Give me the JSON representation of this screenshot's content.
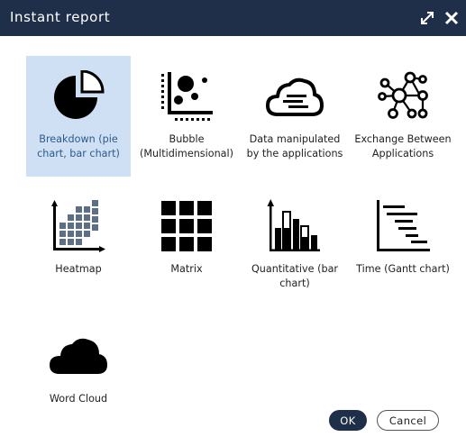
{
  "dialog": {
    "title": "Instant report",
    "expand_icon": "expand-icon",
    "close_icon": "close-icon"
  },
  "tiles": [
    {
      "label": "Breakdown (pie chart, bar chart)",
      "icon": "pie-chart-icon",
      "selected": true
    },
    {
      "label": "Bubble (Multidimensional)",
      "icon": "bubble-chart-icon",
      "selected": false
    },
    {
      "label": "Data manipulated by the applications",
      "icon": "cloud-data-icon",
      "selected": false
    },
    {
      "label": "Exchange Between Applications",
      "icon": "network-graph-icon",
      "selected": false
    },
    {
      "label": "Heatmap",
      "icon": "heatmap-icon",
      "selected": false
    },
    {
      "label": "Matrix",
      "icon": "matrix-grid-icon",
      "selected": false
    },
    {
      "label": "Quantitative (bar chart)",
      "icon": "bar-chart-icon",
      "selected": false
    },
    {
      "label": "Time (Gantt chart)",
      "icon": "gantt-chart-icon",
      "selected": false
    },
    {
      "label": "Word Cloud",
      "icon": "cloud-icon",
      "selected": false
    }
  ],
  "buttons": {
    "ok": "OK",
    "cancel": "Cancel"
  },
  "colors": {
    "titlebar": "#1f2f49",
    "selected_tile": "#cfe0f4",
    "selected_label": "#2d5a8a",
    "heatmap_cells": "#5d6e87"
  }
}
